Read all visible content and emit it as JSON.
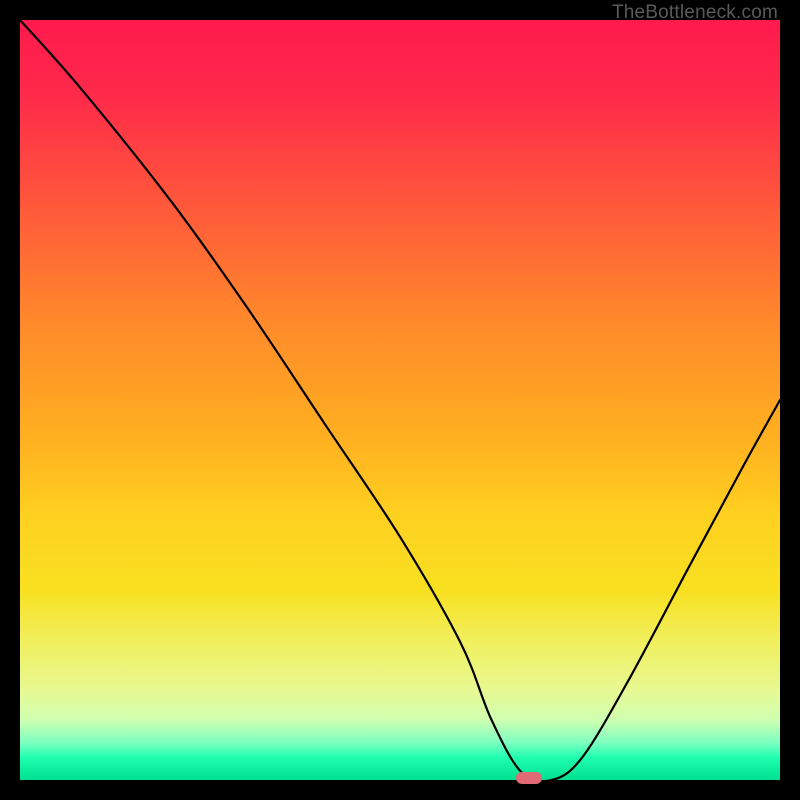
{
  "watermark": "TheBottleneck.com",
  "chart_data": {
    "type": "line",
    "title": "",
    "xlabel": "",
    "ylabel": "",
    "xlim": [
      0,
      100
    ],
    "ylim": [
      0,
      100
    ],
    "grid": false,
    "legend": false,
    "series": [
      {
        "name": "bottleneck-curve",
        "x": [
          0,
          8,
          20,
          30,
          40,
          50,
          58,
          62,
          66,
          70,
          74,
          80,
          88,
          95,
          100
        ],
        "values": [
          100,
          91,
          76,
          62,
          47,
          32,
          18,
          8,
          1,
          0,
          3,
          13,
          28,
          41,
          50
        ]
      }
    ],
    "marker": {
      "x": 67,
      "y": 0,
      "color": "#e06a75"
    },
    "background_gradient": {
      "top": "#ff1a4d",
      "mid": "#ffd020",
      "bottom": "#00e090"
    }
  }
}
